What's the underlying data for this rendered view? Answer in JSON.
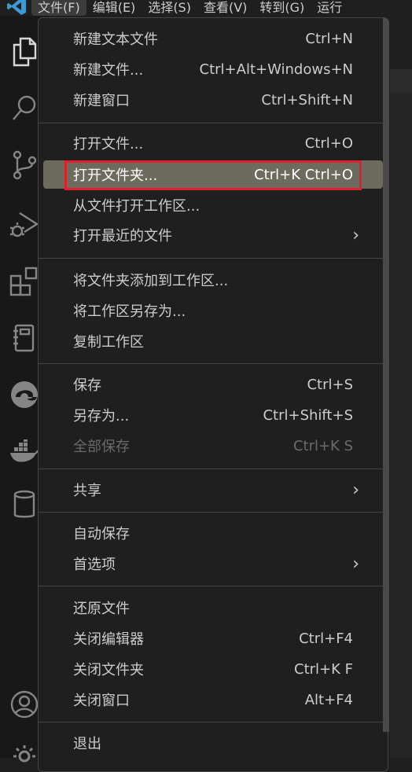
{
  "menubar": {
    "items": [
      {
        "label": "文件(F)",
        "active": true
      },
      {
        "label": "编辑(E)",
        "active": false
      },
      {
        "label": "选择(S)",
        "active": false
      },
      {
        "label": "查看(V)",
        "active": false
      },
      {
        "label": "转到(G)",
        "active": false
      },
      {
        "label": "运行",
        "active": false
      }
    ]
  },
  "activitybar": {
    "icons": [
      "explorer-icon",
      "search-icon",
      "source-control-icon",
      "run-debug-icon",
      "extensions-icon",
      "notebook-icon",
      "edge-icon",
      "docker-icon",
      "database-icon",
      "account-icon",
      "settings-gear-icon"
    ]
  },
  "file_menu": {
    "groups": [
      [
        {
          "label": "新建文本文件",
          "shortcut": "Ctrl+N"
        },
        {
          "label": "新建文件...",
          "shortcut": "Ctrl+Alt+Windows+N"
        },
        {
          "label": "新建窗口",
          "shortcut": "Ctrl+Shift+N"
        }
      ],
      [
        {
          "label": "打开文件...",
          "shortcut": "Ctrl+O"
        },
        {
          "label": "打开文件夹...",
          "shortcut": "Ctrl+K Ctrl+O",
          "highlighted": true
        },
        {
          "label": "从文件打开工作区...",
          "shortcut": ""
        },
        {
          "label": "打开最近的文件",
          "shortcut": "",
          "submenu": true
        }
      ],
      [
        {
          "label": "将文件夹添加到工作区...",
          "shortcut": ""
        },
        {
          "label": "将工作区另存为...",
          "shortcut": ""
        },
        {
          "label": "复制工作区",
          "shortcut": ""
        }
      ],
      [
        {
          "label": "保存",
          "shortcut": "Ctrl+S"
        },
        {
          "label": "另存为...",
          "shortcut": "Ctrl+Shift+S"
        },
        {
          "label": "全部保存",
          "shortcut": "Ctrl+K S",
          "disabled": true
        }
      ],
      [
        {
          "label": "共享",
          "shortcut": "",
          "submenu": true
        }
      ],
      [
        {
          "label": "自动保存",
          "shortcut": ""
        },
        {
          "label": "首选项",
          "shortcut": "",
          "submenu": true
        }
      ],
      [
        {
          "label": "还原文件",
          "shortcut": ""
        },
        {
          "label": "关闭编辑器",
          "shortcut": "Ctrl+F4"
        },
        {
          "label": "关闭文件夹",
          "shortcut": "Ctrl+K F"
        },
        {
          "label": "关闭窗口",
          "shortcut": "Alt+F4"
        }
      ],
      [
        {
          "label": "退出",
          "shortcut": ""
        }
      ]
    ]
  },
  "colors": {
    "accent_blue": "#3c99d4",
    "highlight_bg": "#6d6b5d",
    "annotation_red": "#e0202a"
  }
}
